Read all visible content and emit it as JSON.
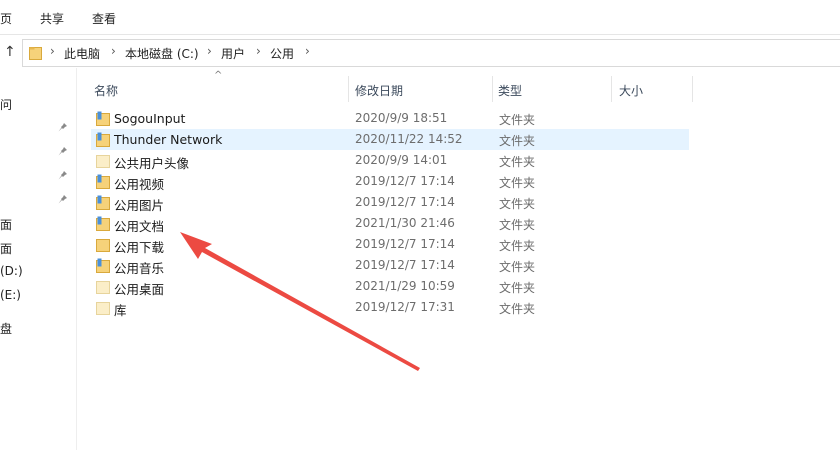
{
  "ribbon": {
    "tabs": [
      "页",
      "共享",
      "查看"
    ]
  },
  "address": {
    "crumbs": [
      "此电脑",
      "本地磁盘 (C:)",
      "用户",
      "公用"
    ]
  },
  "nav": {
    "items": [
      "问",
      "面",
      "面",
      "(D:)",
      "(E:)",
      "盘"
    ]
  },
  "columns": {
    "name": "名称",
    "date": "修改日期",
    "type": "类型",
    "size": "大小"
  },
  "files": [
    {
      "name": "SogouInput",
      "date": "2020/9/9 18:51",
      "type": "文件夹",
      "icon": "folder-doc-icon",
      "selected": false
    },
    {
      "name": "Thunder Network",
      "date": "2020/11/22 14:52",
      "type": "文件夹",
      "icon": "folder-doc-icon",
      "selected": true
    },
    {
      "name": "公共用户头像",
      "date": "2020/9/9 14:01",
      "type": "文件夹",
      "icon": "folder-empty-icon",
      "selected": false
    },
    {
      "name": "公用视频",
      "date": "2019/12/7 17:14",
      "type": "文件夹",
      "icon": "folder-doc-icon",
      "selected": false
    },
    {
      "name": "公用图片",
      "date": "2019/12/7 17:14",
      "type": "文件夹",
      "icon": "folder-doc-icon",
      "selected": false
    },
    {
      "name": "公用文档",
      "date": "2021/1/30 21:46",
      "type": "文件夹",
      "icon": "folder-doc-icon",
      "selected": false
    },
    {
      "name": "公用下载",
      "date": "2019/12/7 17:14",
      "type": "文件夹",
      "icon": "folder-icon",
      "selected": false
    },
    {
      "name": "公用音乐",
      "date": "2019/12/7 17:14",
      "type": "文件夹",
      "icon": "folder-doc-icon",
      "selected": false
    },
    {
      "name": "公用桌面",
      "date": "2021/1/29 10:59",
      "type": "文件夹",
      "icon": "folder-empty-icon",
      "selected": false
    },
    {
      "name": "库",
      "date": "2019/12/7 17:31",
      "type": "文件夹",
      "icon": "folder-empty-icon",
      "selected": false
    }
  ],
  "colors": {
    "folder": "#f2c55c",
    "selected_row": "#e5f3ff",
    "annotation_arrow": "#ec4a42"
  }
}
